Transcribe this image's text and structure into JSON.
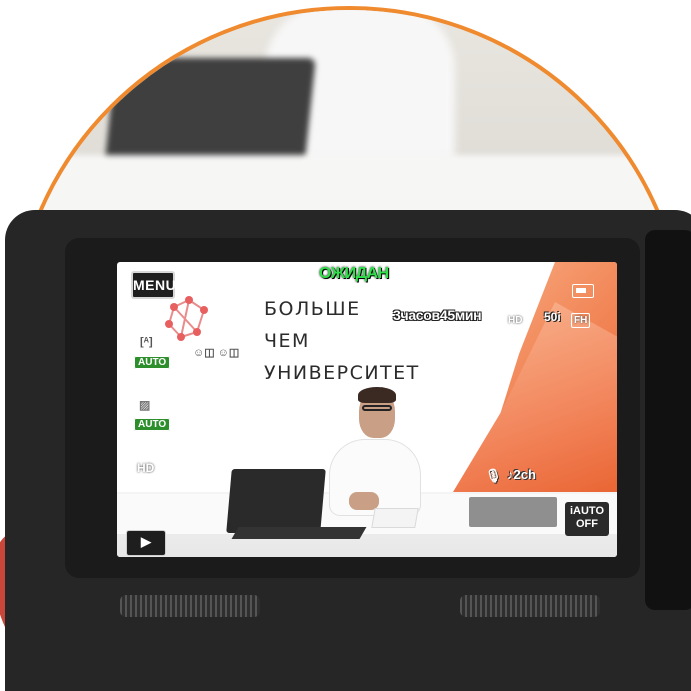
{
  "camera_osd": {
    "menu_label": "MENU",
    "status": "ОЖИДАН",
    "remaining_time": "3часов45мин",
    "quality_badge": "HD",
    "frame_rate": "50i",
    "mode_badge": "FH",
    "iris_mode": "AUTO",
    "focus_mode": "AUTO",
    "hd_indicator": "HD",
    "audio_channels": "♪2ch",
    "iauto_label": "iAUTO",
    "iauto_state": "OFF",
    "playback_icon": "play-icon"
  },
  "backdrop": {
    "slogan_lines": [
      "БОЛЬШЕ",
      "ЧЕМ",
      "УНИВЕРСИТЕТ"
    ]
  },
  "colors": {
    "frame_ring": "#f08a2e",
    "standby_text": "#2fe04a",
    "auto_badge": "#2c8f2c",
    "blob": "#c8463a"
  }
}
